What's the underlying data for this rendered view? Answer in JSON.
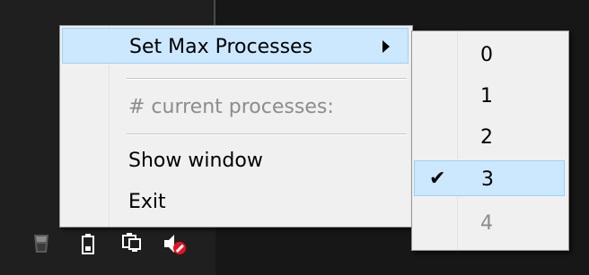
{
  "context_menu": {
    "items": [
      {
        "label": "Set Max Processes",
        "has_submenu": true,
        "highlighted": true
      },
      {
        "label": "# current processes:",
        "disabled": true
      },
      {
        "label": "Show window"
      },
      {
        "label": "Exit"
      }
    ]
  },
  "submenu": {
    "items": [
      {
        "label": "0"
      },
      {
        "label": "1"
      },
      {
        "label": "2"
      },
      {
        "label": "3",
        "checked": true,
        "check_glyph": "✔"
      },
      {
        "label": "4",
        "disabled": true
      }
    ]
  },
  "tray": {
    "icons": [
      "app-tray-icon",
      "battery-icon",
      "network-icon",
      "volume-muted-icon"
    ]
  },
  "colors": {
    "highlight_bg": "#cce8ff",
    "highlight_border": "#99d1ff",
    "menu_bg": "#f0f0f0",
    "disabled_text": "#8c8c8c",
    "mute_red": "#e81123"
  }
}
